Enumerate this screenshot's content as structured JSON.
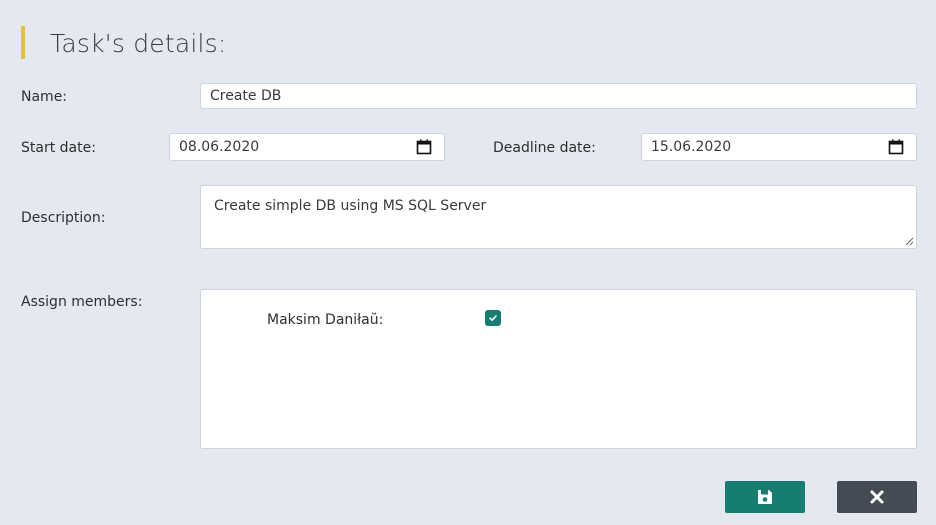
{
  "page": {
    "title": "Task's details:"
  },
  "form": {
    "name": {
      "label": "Name:",
      "value": "Create DB"
    },
    "start_date": {
      "label": "Start date:",
      "value": "08.06.2020"
    },
    "deadline_date": {
      "label": "Deadline date:",
      "value": "15.06.2020"
    },
    "description": {
      "label": "Description:",
      "value": "Create simple DB using MS SQL Server"
    },
    "assign_members": {
      "label": "Assign members:",
      "members": [
        {
          "name": "Maksim Daniłaŭ:",
          "checked": true
        }
      ]
    }
  },
  "actions": {
    "save_icon": "floppy-disk-icon",
    "cancel_icon": "close-icon"
  },
  "colors": {
    "background": "#e4e8f0",
    "accent_bar": "#e2bf3c",
    "save_button": "#177d70",
    "cancel_button": "#454b55",
    "checkbox": "#177d70"
  }
}
